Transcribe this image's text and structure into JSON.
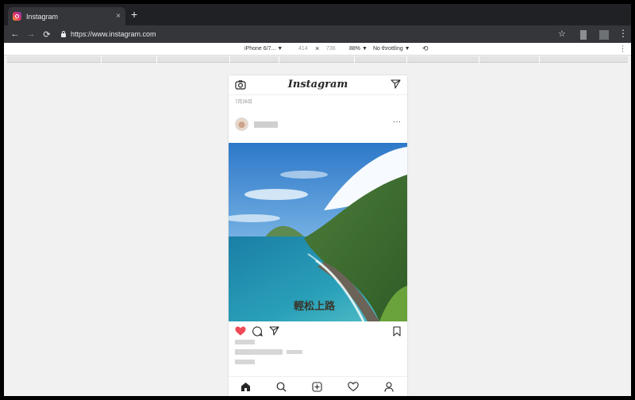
{
  "browser": {
    "tab_title": "Instagram",
    "tab_close": "×",
    "new_tab": "+",
    "back": "←",
    "forward": "→",
    "reload": "⟳",
    "url": "https://www.instagram.com",
    "star": "☆",
    "menu": "⋮"
  },
  "devtools": {
    "device": "iPhone 6/7... ▼",
    "width": "414",
    "times": "×",
    "height": "736",
    "zoom": "88% ▼",
    "throttle": "No throttling ▼",
    "rotate": "⟲"
  },
  "instagram": {
    "logo": "Instagram",
    "post_date": "7月26日",
    "more": "···",
    "icons": [
      "camera-icon",
      "send-icon",
      "heart-icon",
      "comment-icon",
      "share-icon",
      "bookmark-icon",
      "home-icon",
      "search-icon",
      "new-post-icon",
      "activity-icon",
      "profile-icon"
    ],
    "accent_like": "#ed4956"
  }
}
